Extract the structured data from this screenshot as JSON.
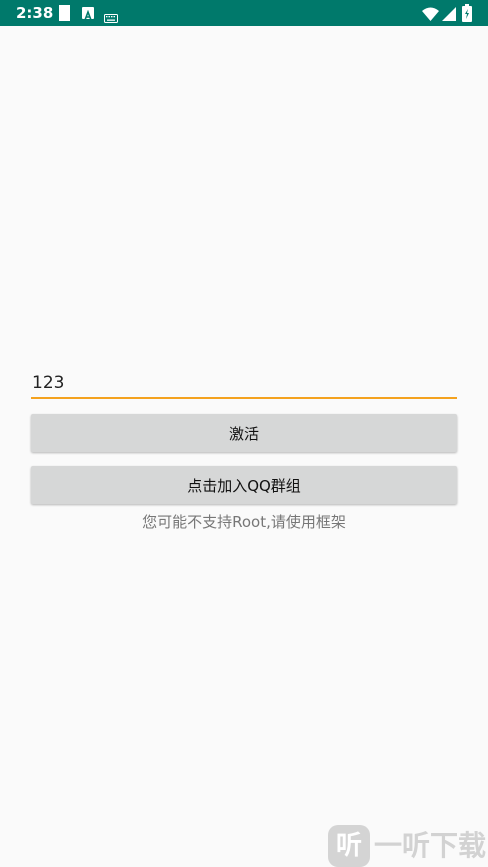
{
  "status_bar": {
    "time": "2:38",
    "background": "#00796b",
    "icons": [
      "sim-card-icon",
      "a-badge-icon",
      "keyboard-icon",
      "wifi-icon",
      "cell-signal-icon",
      "battery-icon"
    ]
  },
  "form": {
    "code_input_value": "123",
    "accent_color": "#f4a21e"
  },
  "buttons": {
    "activate_label": "激活",
    "join_qq_label": "点击加入QQ群组"
  },
  "hint_text": "您可能不支持Root,请使用框架",
  "watermark": {
    "logo_char": "听",
    "text": "一听下载"
  }
}
